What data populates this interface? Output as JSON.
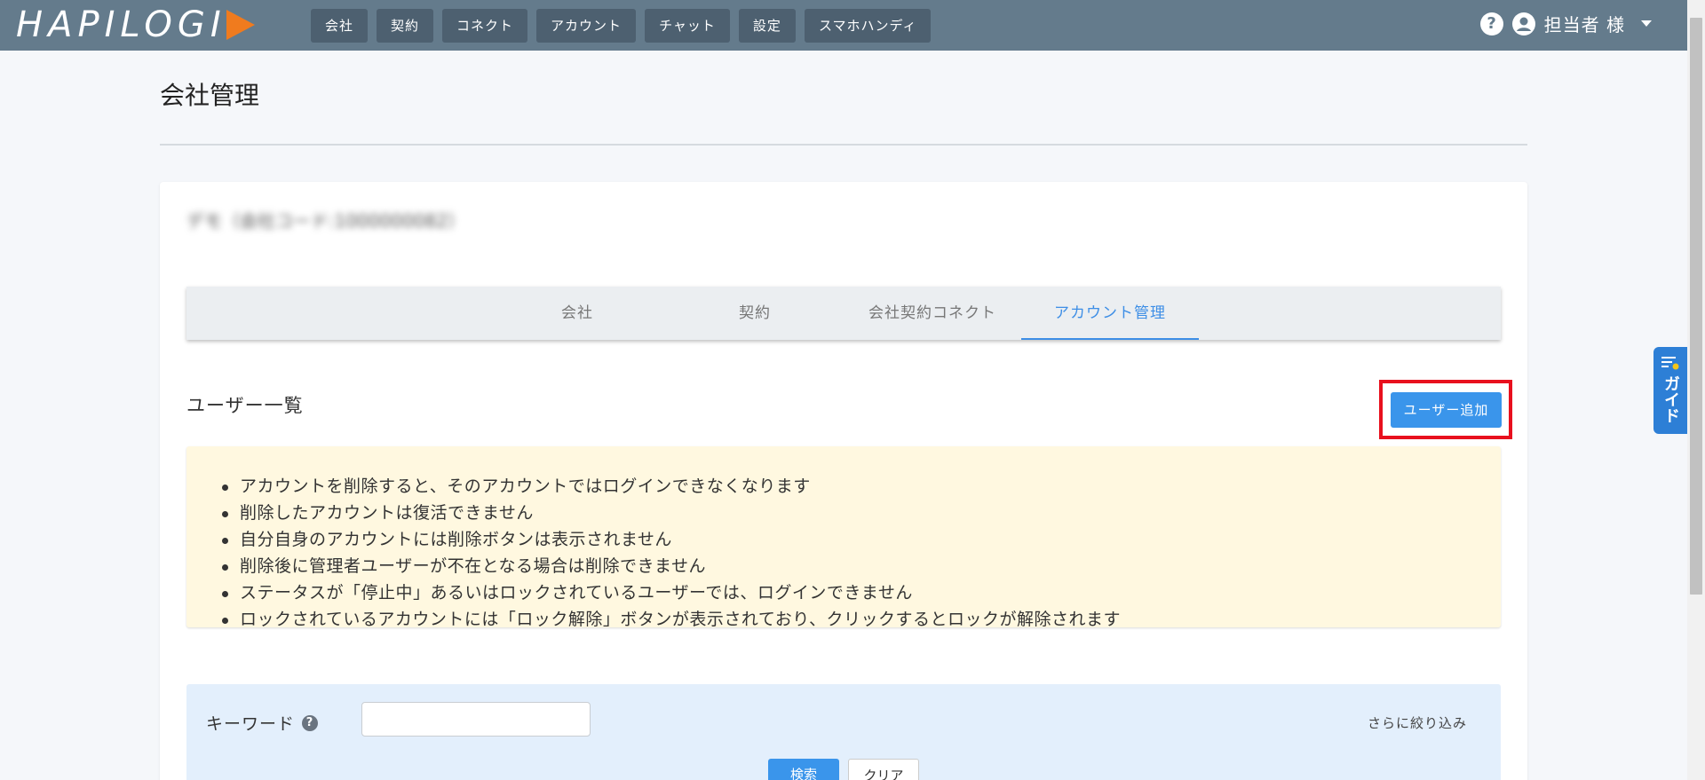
{
  "header": {
    "logo_text": "HAPILOGI",
    "nav": [
      "会社",
      "契約",
      "コネクト",
      "アカウント",
      "チャット",
      "設定",
      "スマホハンディ"
    ],
    "user_label": "担当者 様"
  },
  "page": {
    "title": "会社管理",
    "company_name": "デモ（会社コード:1000000082）"
  },
  "tabs": [
    {
      "label": "会社",
      "active": false
    },
    {
      "label": "契約",
      "active": false
    },
    {
      "label": "会社契約コネクト",
      "active": false
    },
    {
      "label": "アカウント管理",
      "active": true
    }
  ],
  "users": {
    "section_title": "ユーザー一覧",
    "add_button": "ユーザー追加"
  },
  "notice": [
    "アカウントを削除すると、そのアカウントではログインできなくなります",
    "削除したアカウントは復活できません",
    "自分自身のアカウントには削除ボタンは表示されません",
    "削除後に管理者ユーザーが不在となる場合は削除できません",
    "ステータスが「停止中」あるいはロックされているユーザーでは、ログインできません",
    "ロックされているアカウントには「ロック解除」ボタンが表示されており、クリックするとロックが解除されます"
  ],
  "search": {
    "keyword_label": "キーワード",
    "keyword_value": "",
    "narrow_link": "さらに絞り込み",
    "search_button": "検索",
    "clear_button": "クリア"
  },
  "guide": {
    "label": "ガイド"
  },
  "colors": {
    "header_bg": "#647b8c",
    "nav_btn_bg": "#4d6070",
    "accent_blue": "#3a95eb",
    "logo_triangle": "#f07b1e",
    "highlight_red": "#e8101e",
    "notice_bg": "#fff8e0",
    "search_bg": "#e3effc"
  }
}
